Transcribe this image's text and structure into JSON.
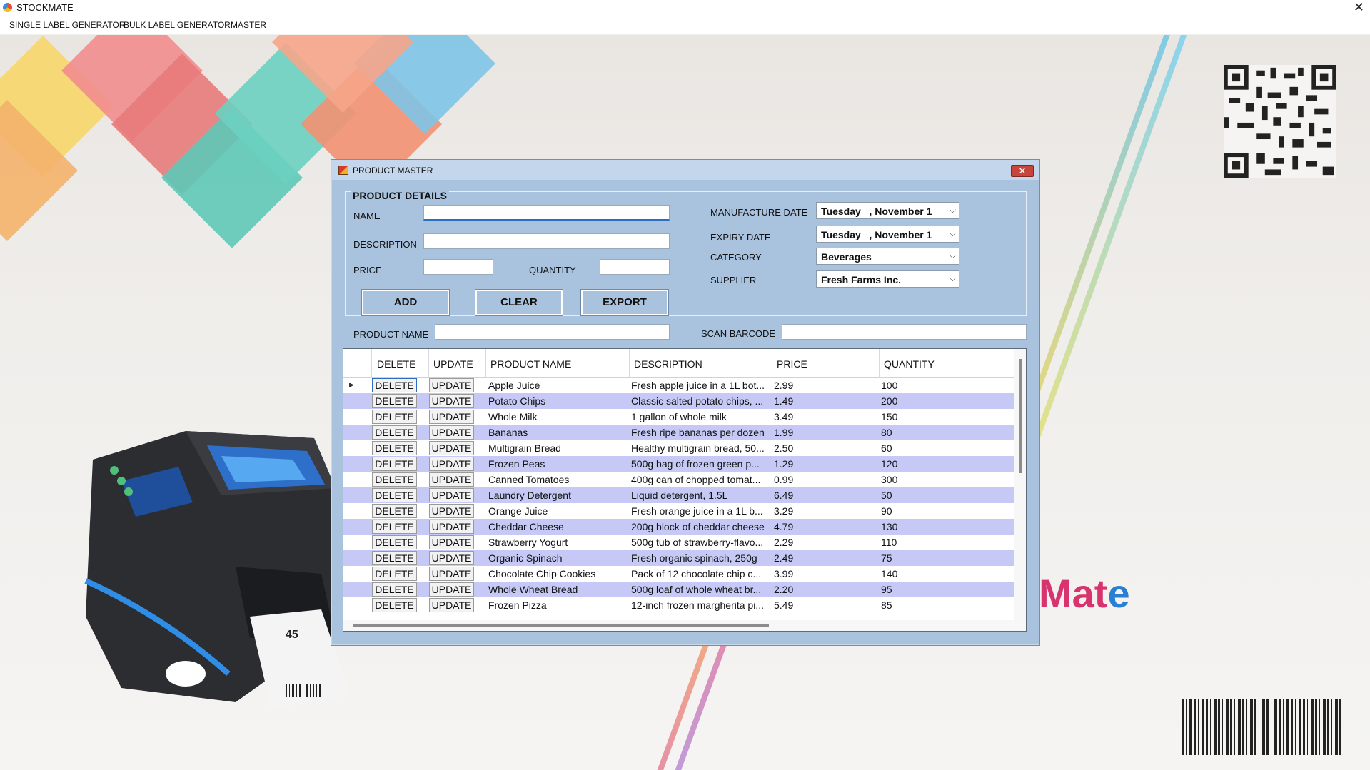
{
  "window": {
    "title": "STOCKMATE",
    "close": "✕"
  },
  "menu": {
    "items": [
      "SINGLE LABEL GENERATOR",
      "BULK LABEL GENERATOR",
      "MASTER"
    ]
  },
  "background": {
    "brand_text_a": "Mat",
    "brand_text_b": "e",
    "label_sample": "45"
  },
  "dialog": {
    "title": "PRODUCT MASTER",
    "close": "✕",
    "group_title": "PRODUCT DETAILS",
    "labels": {
      "name": "NAME",
      "description": "DESCRIPTION",
      "price": "PRICE",
      "quantity": "QUANTITY",
      "manufacture_date": "MANUFACTURE DATE",
      "expiry_date": "EXPIRY DATE",
      "category": "CATEGORY",
      "supplier": "SUPPLIER",
      "product_name": "PRODUCT NAME",
      "scan_barcode": "SCAN BARCODE"
    },
    "values": {
      "name": "",
      "description": "",
      "price": "",
      "quantity": "",
      "product_name_search": "",
      "scan_barcode": "",
      "manufacture_date": "Tuesday   , November 1",
      "expiry_date": "Tuesday   , November 1",
      "category": "Beverages",
      "supplier": "Fresh Farms Inc."
    },
    "buttons": {
      "add": "ADD",
      "clear": "CLEAR",
      "export": "EXPORT"
    },
    "grid": {
      "columns": [
        "DELETE",
        "UPDATE",
        "PRODUCT NAME",
        "DESCRIPTION",
        "PRICE",
        "QUANTITY"
      ],
      "delete_label": "DELETE",
      "update_label": "UPDATE",
      "rows": [
        {
          "name": "Apple Juice",
          "description": "Fresh apple juice in a 1L bot...",
          "price": "2.99",
          "quantity": "100"
        },
        {
          "name": "Potato Chips",
          "description": "Classic salted potato chips, ...",
          "price": "1.49",
          "quantity": "200"
        },
        {
          "name": "Whole Milk",
          "description": "1 gallon of whole milk",
          "price": "3.49",
          "quantity": "150"
        },
        {
          "name": "Bananas",
          "description": "Fresh ripe bananas per dozen",
          "price": "1.99",
          "quantity": "80"
        },
        {
          "name": "Multigrain Bread",
          "description": "Healthy multigrain bread, 50...",
          "price": "2.50",
          "quantity": "60"
        },
        {
          "name": "Frozen Peas",
          "description": "500g bag of frozen green p...",
          "price": "1.29",
          "quantity": "120"
        },
        {
          "name": "Canned Tomatoes",
          "description": "400g can of chopped tomat...",
          "price": "0.99",
          "quantity": "300"
        },
        {
          "name": "Laundry Detergent",
          "description": "Liquid detergent, 1.5L",
          "price": "6.49",
          "quantity": "50"
        },
        {
          "name": "Orange Juice",
          "description": "Fresh orange juice in a 1L b...",
          "price": "3.29",
          "quantity": "90"
        },
        {
          "name": "Cheddar Cheese",
          "description": "200g block of cheddar cheese",
          "price": "4.79",
          "quantity": "130"
        },
        {
          "name": "Strawberry Yogurt",
          "description": "500g tub of strawberry-flavo...",
          "price": "2.29",
          "quantity": "110"
        },
        {
          "name": "Organic Spinach",
          "description": "Fresh organic spinach, 250g",
          "price": "2.49",
          "quantity": "75"
        },
        {
          "name": "Chocolate Chip Cookies",
          "description": "Pack of 12 chocolate chip c...",
          "price": "3.99",
          "quantity": "140"
        },
        {
          "name": "Whole Wheat Bread",
          "description": "500g loaf of whole wheat br...",
          "price": "2.20",
          "quantity": "95"
        },
        {
          "name": "Frozen Pizza",
          "description": "12-inch frozen margherita pi...",
          "price": "5.49",
          "quantity": "85"
        }
      ]
    }
  },
  "colors": {
    "dialog_bg": "#a9c2de",
    "alt_row": "#c6c9f5",
    "accent": "#2b6cc4"
  }
}
